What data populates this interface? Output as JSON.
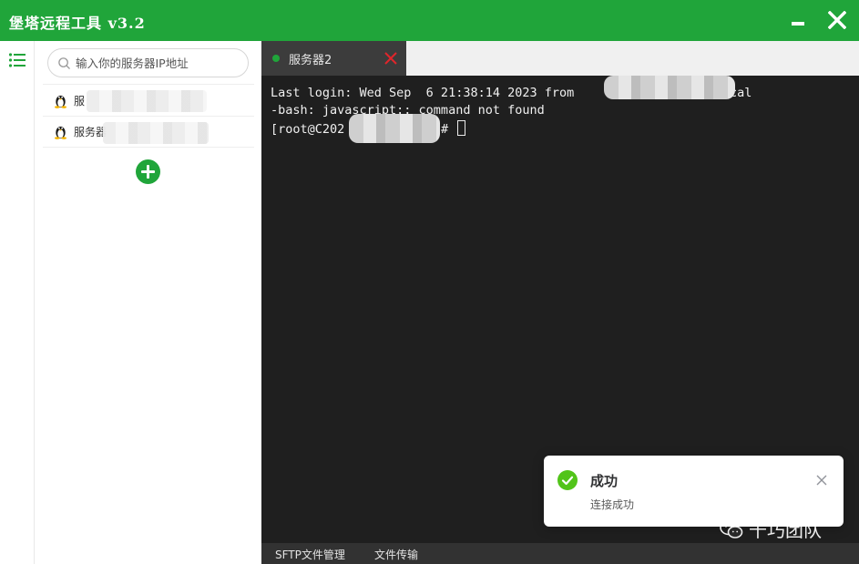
{
  "window": {
    "title": "堡塔远程工具 v3.2",
    "accent_color": "#20a53a"
  },
  "sidebar": {
    "menu_icon": "list-icon"
  },
  "server_panel": {
    "search_placeholder": "输入你的服务器IP地址",
    "servers": [
      {
        "name": "服",
        "os_icon": "linux-tux-icon"
      },
      {
        "name": "服务器",
        "os_icon": "linux-tux-icon"
      }
    ],
    "add_icon": "plus-circle-icon"
  },
  "tabs": [
    {
      "label": "服务器2",
      "status": "connected",
      "status_color": "#20a53a",
      "close_icon": "close-x-icon"
    }
  ],
  "terminal": {
    "line1_prefix": "Last login: Wed Sep  6 21:38:14 2023 from",
    "line1_suffix": "local",
    "line2": "-bash: javascript:: command not found",
    "prompt_start": "[root@C202",
    "prompt_end": "~]#"
  },
  "bottom_bar": {
    "sftp_label": "SFTP文件管理",
    "transfer_label": "文件传输"
  },
  "toast": {
    "title": "成功",
    "message": "连接成功",
    "icon": "check-circle-icon"
  },
  "watermark": {
    "text": "千巧团队"
  }
}
